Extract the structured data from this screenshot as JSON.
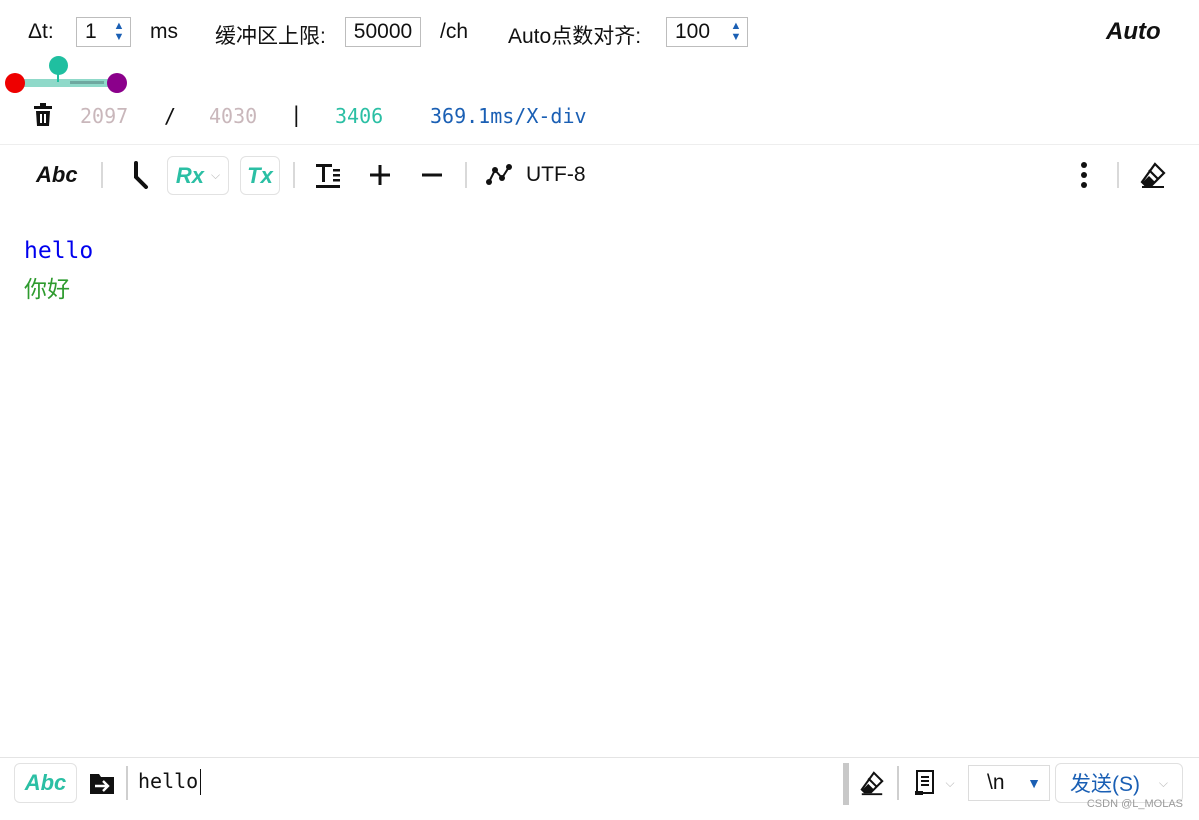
{
  "top": {
    "dt_label": "Δt:",
    "dt_value": "1",
    "dt_unit": "ms",
    "buffer_label": "缓冲区上限:",
    "buffer_value": "50000",
    "buffer_unit": "/ch",
    "align_label": "Auto点数对齐:",
    "align_value": "100",
    "auto_label": "Auto"
  },
  "slider": {
    "colors": [
      "#ee0000",
      "#1fbfa0",
      "#8b008b"
    ]
  },
  "stats": {
    "count_a": "2097",
    "slash": "/",
    "count_b": "4030",
    "bar": "|",
    "count_c": "3406",
    "xdiv": "369.1ms/X-div"
  },
  "toolbar": {
    "abc_label": "Abc",
    "rx_label": "Rx",
    "tx_label": "Tx",
    "encoding_label": "UTF-8",
    "icons": [
      "trash-icon",
      "hook-icon",
      "text-format-icon",
      "plus-icon",
      "minus-icon",
      "plot-icon",
      "more-icon",
      "eraser-icon"
    ]
  },
  "output": {
    "lines": [
      {
        "text": "hello",
        "color": "#0000ee"
      },
      {
        "text": "你好",
        "color": "#2e9b2e"
      }
    ]
  },
  "bottom": {
    "abc_label": "Abc",
    "input_value": "hello",
    "line_ending": "\\n",
    "send_label": "发送(S)"
  },
  "watermark": "CSDN @L_MOLAS"
}
